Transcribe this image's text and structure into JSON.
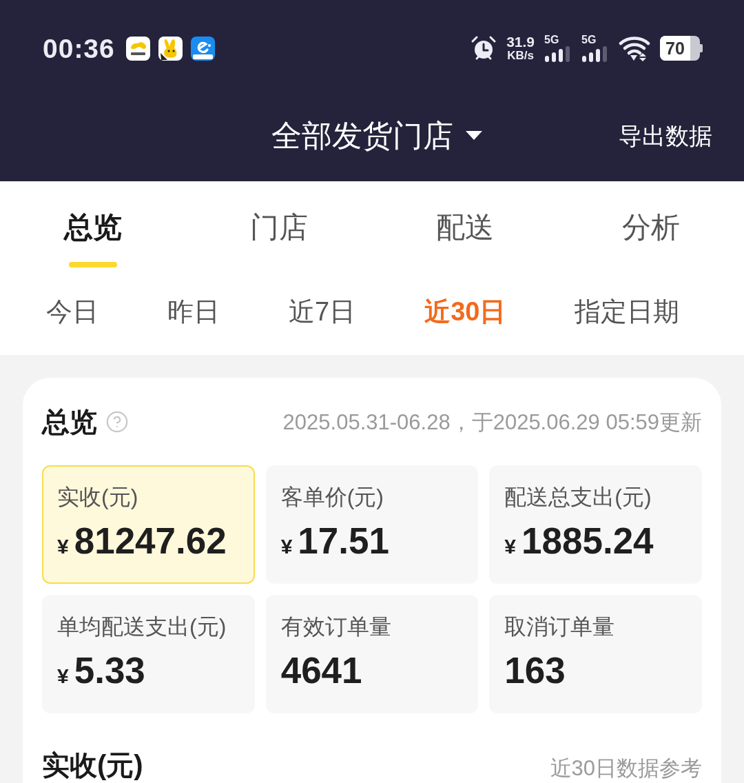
{
  "status_bar": {
    "time": "00:36",
    "net_speed": {
      "value": "31.9",
      "unit": "KB/s"
    },
    "signals": [
      {
        "label": "5G"
      },
      {
        "label": "5G"
      }
    ],
    "battery": "70"
  },
  "header": {
    "title": "全部发货门店",
    "action": "导出数据"
  },
  "tabs": [
    {
      "label": "总览",
      "selected": true
    },
    {
      "label": "门店",
      "selected": false
    },
    {
      "label": "配送",
      "selected": false
    },
    {
      "label": "分析",
      "selected": false
    }
  ],
  "date_filters": [
    {
      "label": "今日",
      "selected": false
    },
    {
      "label": "昨日",
      "selected": false
    },
    {
      "label": "近7日",
      "selected": false
    },
    {
      "label": "近30日",
      "selected": true
    },
    {
      "label": "指定日期",
      "selected": false
    }
  ],
  "overview": {
    "title": "总览",
    "period": "2025.05.31-06.28，于2025.06.29 05:59更新",
    "metrics": [
      {
        "label": "实收(元)",
        "currency": "¥",
        "value": "81247.62",
        "selected": true
      },
      {
        "label": "客单价(元)",
        "currency": "¥",
        "value": "17.51",
        "selected": false
      },
      {
        "label": "配送总支出(元)",
        "currency": "¥",
        "value": "1885.24",
        "selected": false
      },
      {
        "label": "单均配送支出(元)",
        "currency": "¥",
        "value": "5.33",
        "selected": false
      },
      {
        "label": "有效订单量",
        "value": "4641",
        "selected": false
      },
      {
        "label": "取消订单量",
        "value": "163",
        "selected": false
      }
    ]
  },
  "revenue_section": {
    "title": "实收(元)",
    "note": "近30日数据参考"
  }
}
